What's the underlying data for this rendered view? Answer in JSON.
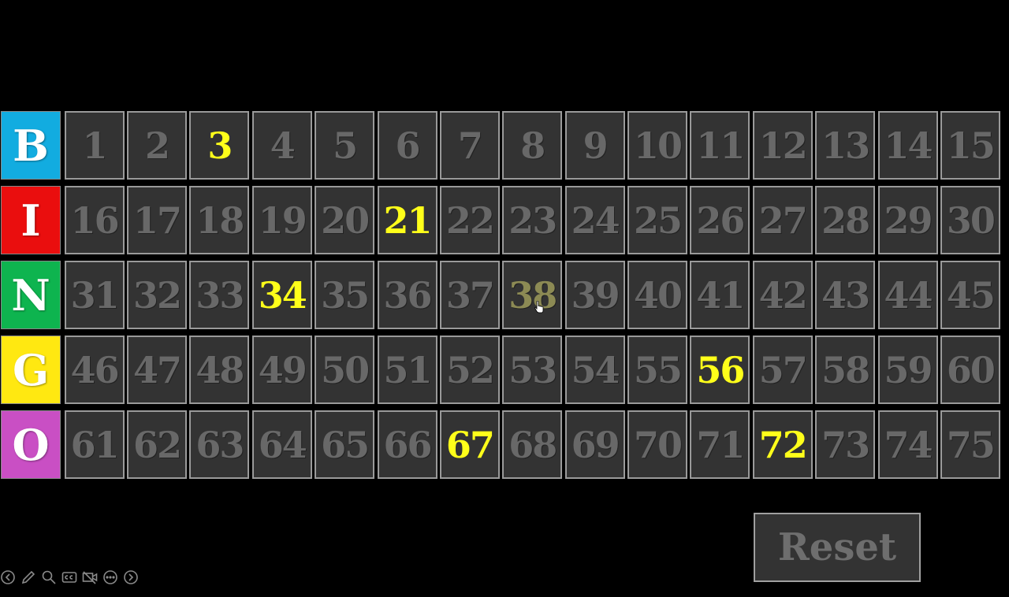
{
  "board": {
    "rows": [
      {
        "letter": "B",
        "color": "#12ace0",
        "numbers": [
          "1",
          "2",
          "3",
          "4",
          "5",
          "6",
          "7",
          "8",
          "9",
          "10",
          "11",
          "12",
          "13",
          "14",
          "15"
        ]
      },
      {
        "letter": "I",
        "color": "#ea0e0e",
        "numbers": [
          "16",
          "17",
          "18",
          "19",
          "20",
          "21",
          "22",
          "23",
          "24",
          "25",
          "26",
          "27",
          "28",
          "29",
          "30"
        ]
      },
      {
        "letter": "N",
        "color": "#0eb44f",
        "numbers": [
          "31",
          "32",
          "33",
          "34",
          "35",
          "36",
          "37",
          "38",
          "39",
          "40",
          "41",
          "42",
          "43",
          "44",
          "45"
        ]
      },
      {
        "letter": "G",
        "color": "#ffe811",
        "numbers": [
          "46",
          "47",
          "48",
          "49",
          "50",
          "51",
          "52",
          "53",
          "54",
          "55",
          "56",
          "57",
          "58",
          "59",
          "60"
        ]
      },
      {
        "letter": "O",
        "color": "#c94fc4",
        "numbers": [
          "61",
          "62",
          "63",
          "64",
          "65",
          "66",
          "67",
          "68",
          "69",
          "70",
          "71",
          "72",
          "73",
          "74",
          "75"
        ]
      }
    ],
    "called": [
      "3",
      "21",
      "34",
      "56",
      "67",
      "72"
    ],
    "hovered": "38",
    "called_color": "#ffff1a",
    "uncalled_color": "#686868"
  },
  "reset_label": "Reset",
  "toolbar": {
    "icons": [
      "back-arrow-icon",
      "pen-icon",
      "zoom-icon",
      "captions-icon",
      "camera-off-icon",
      "more-icon",
      "forward-arrow-icon"
    ]
  }
}
